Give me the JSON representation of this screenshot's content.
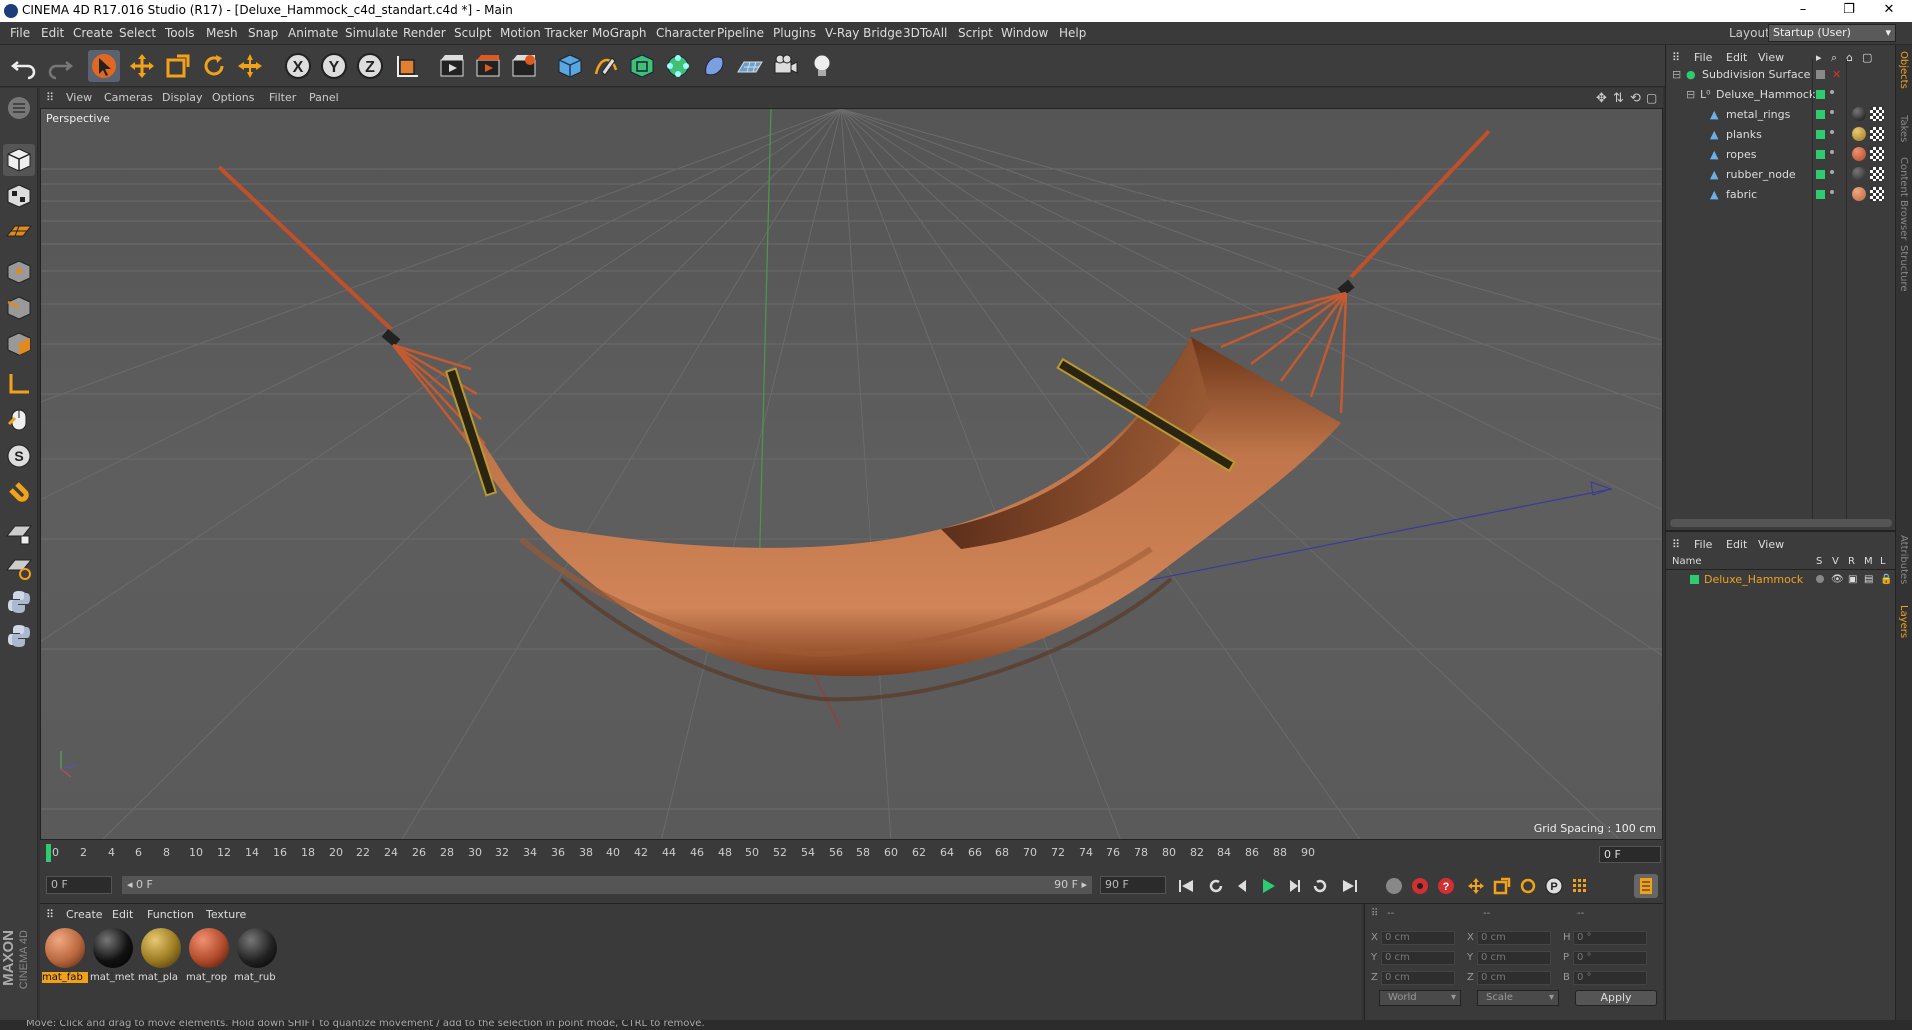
{
  "window": {
    "title": "CINEMA 4D R17.016 Studio (R17) - [Deluxe_Hammock_c4d_standart.c4d *] - Main",
    "minimize": "–",
    "maximize": "❐",
    "close": "✕"
  },
  "menubar": {
    "items": [
      "File",
      "Edit",
      "Create",
      "Select",
      "Tools",
      "Mesh",
      "Snap",
      "Animate",
      "Simulate",
      "Render",
      "Sculpt",
      "Motion Tracker",
      "MoGraph",
      "Character",
      "Pipeline",
      "Plugins",
      "V-Ray Bridge",
      "3DToAll",
      "Script",
      "Window",
      "Help"
    ],
    "layout_label": "Layout:",
    "layout_value": "Startup (User)"
  },
  "toolbar": {
    "icons": [
      "undo-icon",
      "redo-icon",
      "select-arrow-icon",
      "move-icon",
      "scale-icon",
      "rotate-icon",
      "live-select-icon",
      "x-axis-icon",
      "y-axis-icon",
      "z-axis-icon",
      "coordinate-system-icon",
      "render-view-icon",
      "render-picture-viewer-icon",
      "render-settings-icon",
      "cube-icon",
      "pen-spline-icon",
      "subdivision-icon",
      "array-icon",
      "deformer-icon",
      "floor-icon",
      "camera-icon",
      "light-icon"
    ]
  },
  "viewport": {
    "menu": [
      "View",
      "Cameras",
      "Display",
      "Options",
      "Filter",
      "Panel"
    ],
    "label": "Perspective",
    "grid_spacing": "Grid Spacing : 100 cm"
  },
  "timeline": {
    "ticks": [
      "0",
      "2",
      "4",
      "6",
      "8",
      "10",
      "12",
      "14",
      "16",
      "18",
      "20",
      "22",
      "24",
      "26",
      "28",
      "30",
      "32",
      "34",
      "36",
      "38",
      "40",
      "42",
      "44",
      "46",
      "48",
      "50",
      "52",
      "54",
      "56",
      "58",
      "60",
      "62",
      "64",
      "66",
      "68",
      "70",
      "72",
      "74",
      "76",
      "78",
      "80",
      "82",
      "84",
      "86",
      "88",
      "90"
    ],
    "end_frame": "0 F"
  },
  "transport": {
    "current_frame": "0 F",
    "range_start": "◂ 0 F",
    "range_end": "90 F ▸",
    "max_frame": "90 F"
  },
  "material_manager": {
    "menu": [
      "Create",
      "Edit",
      "Function",
      "Texture"
    ],
    "materials": [
      {
        "name": "mat_fab",
        "color": "#b9673e"
      },
      {
        "name": "mat_met",
        "color": "#111111"
      },
      {
        "name": "mat_pla",
        "color": "#9a7a22"
      },
      {
        "name": "mat_rop",
        "color": "#b04a2a"
      },
      {
        "name": "mat_rub",
        "color": "#222222"
      }
    ]
  },
  "coordinates": {
    "dots": [
      "--",
      "--",
      "--"
    ],
    "rows": [
      {
        "a": "X",
        "av": "0 cm",
        "b": "X",
        "bv": "0 cm",
        "c": "H",
        "cv": "0 °"
      },
      {
        "a": "Y",
        "av": "0 cm",
        "b": "Y",
        "bv": "0 cm",
        "c": "P",
        "cv": "0 °"
      },
      {
        "a": "Z",
        "av": "0 cm",
        "b": "Z",
        "bv": "0 cm",
        "c": "B",
        "cv": "0 °"
      }
    ],
    "world": "World",
    "scale": "Scale",
    "apply": "Apply"
  },
  "object_manager": {
    "menu": [
      "File",
      "Edit",
      "View"
    ],
    "objects": [
      {
        "name": "Subdivision Surface",
        "indent": 0
      },
      {
        "name": "Deluxe_Hammock",
        "indent": 1
      },
      {
        "name": "metal_rings",
        "indent": 2,
        "tag": "#111111"
      },
      {
        "name": "planks",
        "indent": 2,
        "tag": "#9a7a22"
      },
      {
        "name": "ropes",
        "indent": 2,
        "tag": "#b04a2a"
      },
      {
        "name": "rubber_node",
        "indent": 2,
        "tag": "#222222"
      },
      {
        "name": "fabric",
        "indent": 2,
        "tag": "#b9673e"
      }
    ]
  },
  "layer_manager": {
    "menu": [
      "File",
      "Edit",
      "View"
    ],
    "columns": [
      "Name",
      "S",
      "V",
      "R",
      "M",
      "L"
    ],
    "row": "Deluxe_Hammock",
    "row_color": "#f0a020"
  },
  "right_tabs": [
    "Objects",
    "Takes",
    "Content Browser",
    "Structure",
    "Attributes",
    "Layers"
  ],
  "statusbar": {
    "text": "Move: Click and drag to move elements. Hold down SHIFT to quantize movement / add to the selection in point mode, CTRL to remove."
  },
  "brand": {
    "line1": "MAXON",
    "line2": "CINEMA 4D"
  }
}
